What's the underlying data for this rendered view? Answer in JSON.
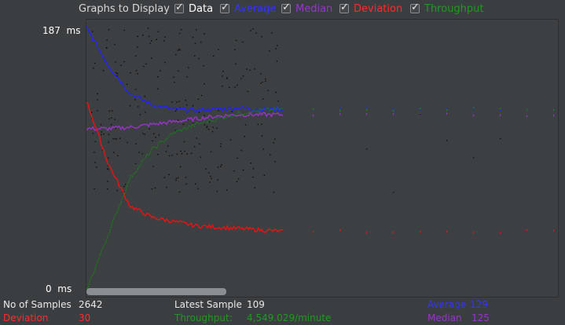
{
  "header": {
    "graphs_to_display_label": "Graphs to Display",
    "checkboxes": [
      {
        "label": "Data",
        "color": "#ffffff",
        "checked": true
      },
      {
        "label": "Average",
        "color": "#3333ff",
        "checked": true
      },
      {
        "label": "Median",
        "color": "#9933cc",
        "checked": true
      },
      {
        "label": "Deviation",
        "color": "#ff2b2b",
        "checked": true
      },
      {
        "label": "Throughput",
        "color": "#1d9b1d",
        "checked": true
      }
    ]
  },
  "axis": {
    "y_max_label": "187",
    "y_min_label": "0",
    "y_unit": "ms"
  },
  "stats": {
    "samples_label": "No of Samples",
    "samples_value": "2642",
    "latest_label": "Latest Sample",
    "latest_value": "109",
    "average_label": "Average",
    "average_value": "129",
    "deviation_label": "Deviation",
    "deviation_value": "30",
    "throughput_label": "Throughput",
    "throughput_value": "4,549.029/minute",
    "median_label": "Median",
    "median_value": "125"
  },
  "colors": {
    "data": "#0a0a0a",
    "average": "#2222ff",
    "median": "#9932cc",
    "deviation": "#ee1111",
    "throughput": "#118811"
  },
  "chart_data": {
    "type": "line",
    "ylim": [
      0,
      187
    ],
    "series": [
      {
        "name": "Average",
        "values": [
          187,
          160,
          140,
          132,
          129,
          128,
          129,
          130,
          129,
          129
        ]
      },
      {
        "name": "Median",
        "values": [
          115,
          115,
          116,
          118,
          120,
          122,
          124,
          125,
          125,
          125
        ]
      },
      {
        "name": "Deviation",
        "values": [
          135,
          90,
          60,
          52,
          49,
          46,
          45,
          44,
          43,
          42
        ]
      },
      {
        "name": "Throughput",
        "values": [
          0,
          40,
          80,
          100,
          112,
          118,
          122,
          126,
          128,
          129
        ]
      }
    ]
  }
}
